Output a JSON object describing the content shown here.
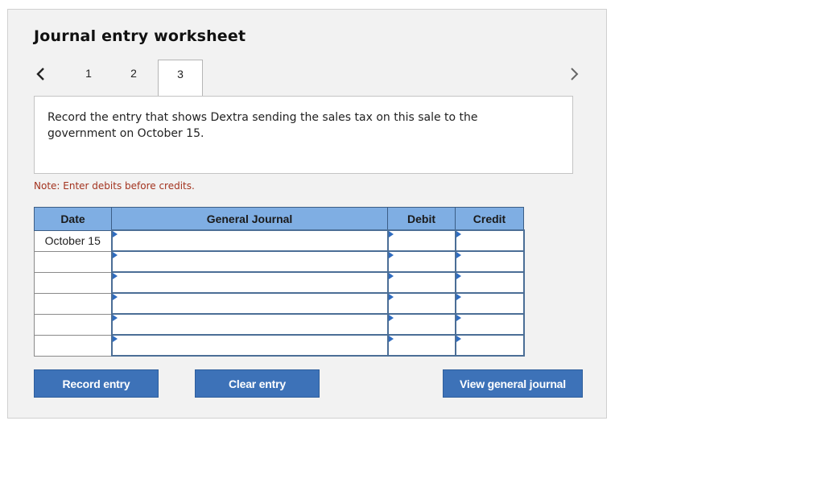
{
  "worksheet": {
    "title": "Journal entry worksheet",
    "tabs": [
      "1",
      "2",
      "3"
    ],
    "active_tab": "3",
    "prompt": "Record the entry that shows Dextra sending the sales tax on this sale to the government on October 15.",
    "note": "Note: Enter debits before credits."
  },
  "table": {
    "headers": {
      "date": "Date",
      "general_journal": "General Journal",
      "debit": "Debit",
      "credit": "Credit"
    },
    "rows": [
      {
        "date": "October 15",
        "account": "",
        "debit": "",
        "credit": ""
      },
      {
        "date": "",
        "account": "",
        "debit": "",
        "credit": ""
      },
      {
        "date": "",
        "account": "",
        "debit": "",
        "credit": ""
      },
      {
        "date": "",
        "account": "",
        "debit": "",
        "credit": ""
      },
      {
        "date": "",
        "account": "",
        "debit": "",
        "credit": ""
      },
      {
        "date": "",
        "account": "",
        "debit": "",
        "credit": ""
      }
    ]
  },
  "buttons": {
    "record": "Record entry",
    "clear": "Clear entry",
    "view": "View general journal"
  },
  "colors": {
    "header_blue": "#7faee3",
    "button_blue": "#3d72b8",
    "note_red": "#a3331f",
    "input_marker": "#2f6cc0"
  },
  "icons": {
    "prev": "chevron-left-icon",
    "next": "chevron-right-icon"
  }
}
